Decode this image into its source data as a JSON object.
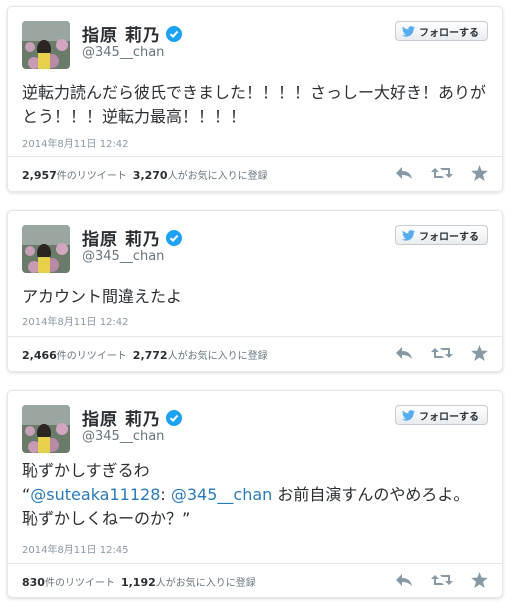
{
  "tweets": [
    {
      "display_name": "指原 莉乃",
      "handle": "@345__chan",
      "follow_label": "フォローする",
      "text": "逆転力読んだら彼氏できました！！！！さっしー大好き！ありがとう！！！逆転力最高！！！！",
      "timestamp": "2014年8月11日 12:42",
      "retweets_count": "2,957",
      "retweets_label": "件のリツイート",
      "favorites_count": "3,270",
      "favorites_label": "人がお気に入りに登録"
    },
    {
      "display_name": "指原 莉乃",
      "handle": "@345__chan",
      "follow_label": "フォローする",
      "text": "アカウント間違えたよ",
      "timestamp": "2014年8月11日 12:42",
      "retweets_count": "2,466",
      "retweets_label": "件のリツイート",
      "favorites_count": "2,772",
      "favorites_label": "人がお気に入りに登録"
    },
    {
      "display_name": "指原 莉乃",
      "handle": "@345__chan",
      "follow_label": "フォローする",
      "text_line1": "恥ずかしすぎるわ",
      "quote_open": "“",
      "mention1": "@suteaka11128",
      "sep": ": ",
      "mention2": "@345__chan",
      "quote_rest": " お前自演すんのやめろよ。",
      "text_line3": "恥ずかしくねーのか？”",
      "timestamp": "2014年8月11日 12:45",
      "retweets_count": "830",
      "retweets_label": "件のリツイート",
      "favorites_count": "1,192",
      "favorites_label": "人がお気に入りに登録"
    }
  ],
  "colors": {
    "link": "#2b7bb9",
    "verified": "#1da1f2",
    "bird": "#55acee",
    "icon": "#8899a6"
  },
  "icons": [
    "avatar",
    "verified-badge-icon",
    "twitter-bird-icon",
    "reply-icon",
    "retweet-icon",
    "favorite-star-icon"
  ]
}
